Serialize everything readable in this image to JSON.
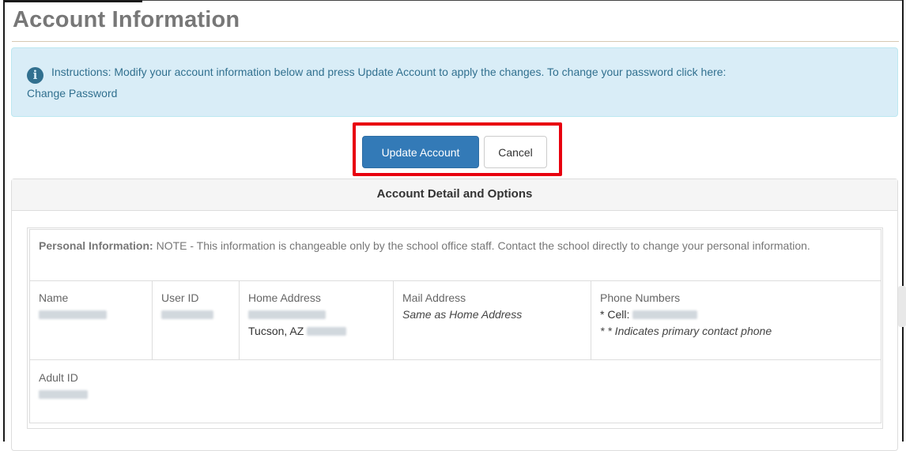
{
  "page": {
    "title": "Account Information"
  },
  "instructions": {
    "text": "Instructions: Modify your account information below and press Update Account to apply the changes. To change your password click here:",
    "link": "Change Password"
  },
  "actions": {
    "update_label": "Update Account",
    "cancel_label": "Cancel"
  },
  "panel": {
    "heading": "Account Detail and Options",
    "personal_note_label": "Personal Information:",
    "personal_note_text": " NOTE - This information is changeable only by the school office staff. Contact the school directly to change your personal information.",
    "columns": {
      "name": "Name",
      "user_id": "User ID",
      "home_address": "Home Address",
      "mail_address": "Mail Address",
      "phone_numbers": "Phone Numbers"
    },
    "home_city": "Tucson, AZ",
    "mail_value": "Same as Home Address",
    "cell_label": "* Cell:",
    "primary_note": "* * Indicates primary contact phone",
    "adult_id_label": "Adult ID"
  },
  "colors": {
    "primary": "#337ab7",
    "info_bg": "#d9edf7",
    "info_text": "#31708f",
    "highlight": "#e8000f"
  }
}
